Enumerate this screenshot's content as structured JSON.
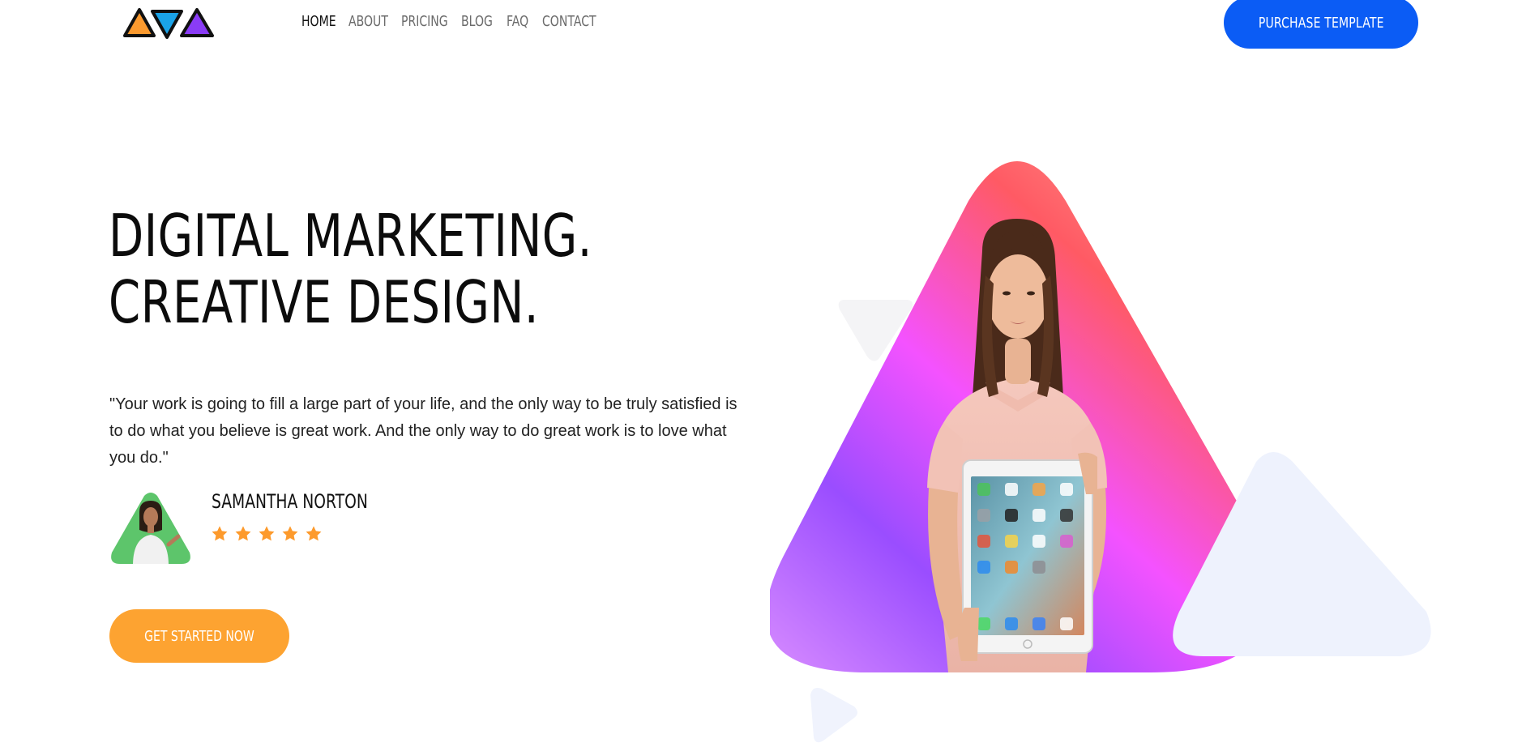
{
  "nav": {
    "items": [
      {
        "label": "HOME",
        "active": true
      },
      {
        "label": "ABOUT",
        "active": false
      },
      {
        "label": "PRICING",
        "active": false
      },
      {
        "label": "BLOG",
        "active": false
      },
      {
        "label": "FAQ",
        "active": false
      },
      {
        "label": "CONTACT",
        "active": false
      }
    ],
    "purchase_label": "PURCHASE TEMPLATE"
  },
  "hero": {
    "headline_line1": "DIGITAL MARKETING.",
    "headline_line2": "CREATIVE DESIGN.",
    "quote": "\"Your work is going to fill a large part of your life, and the only way to be truly satisfied is to do what you believe is great work. And the only way to do great work is to love what you do.\"",
    "author": "SAMANTHA NORTON",
    "rating": 5,
    "cta_label": "GET STARTED NOW"
  },
  "colors": {
    "brand_blue": "#0b5cf5",
    "cta_orange": "#fda331",
    "star_orange": "#fd9a2c",
    "avatar_green": "#5dc56b",
    "logo_orange": "#fb9a2f",
    "logo_blue": "#1aa3e8",
    "logo_purple": "#8a3cf6"
  },
  "icons": [
    "logo-triangles-icon",
    "star-icon"
  ]
}
